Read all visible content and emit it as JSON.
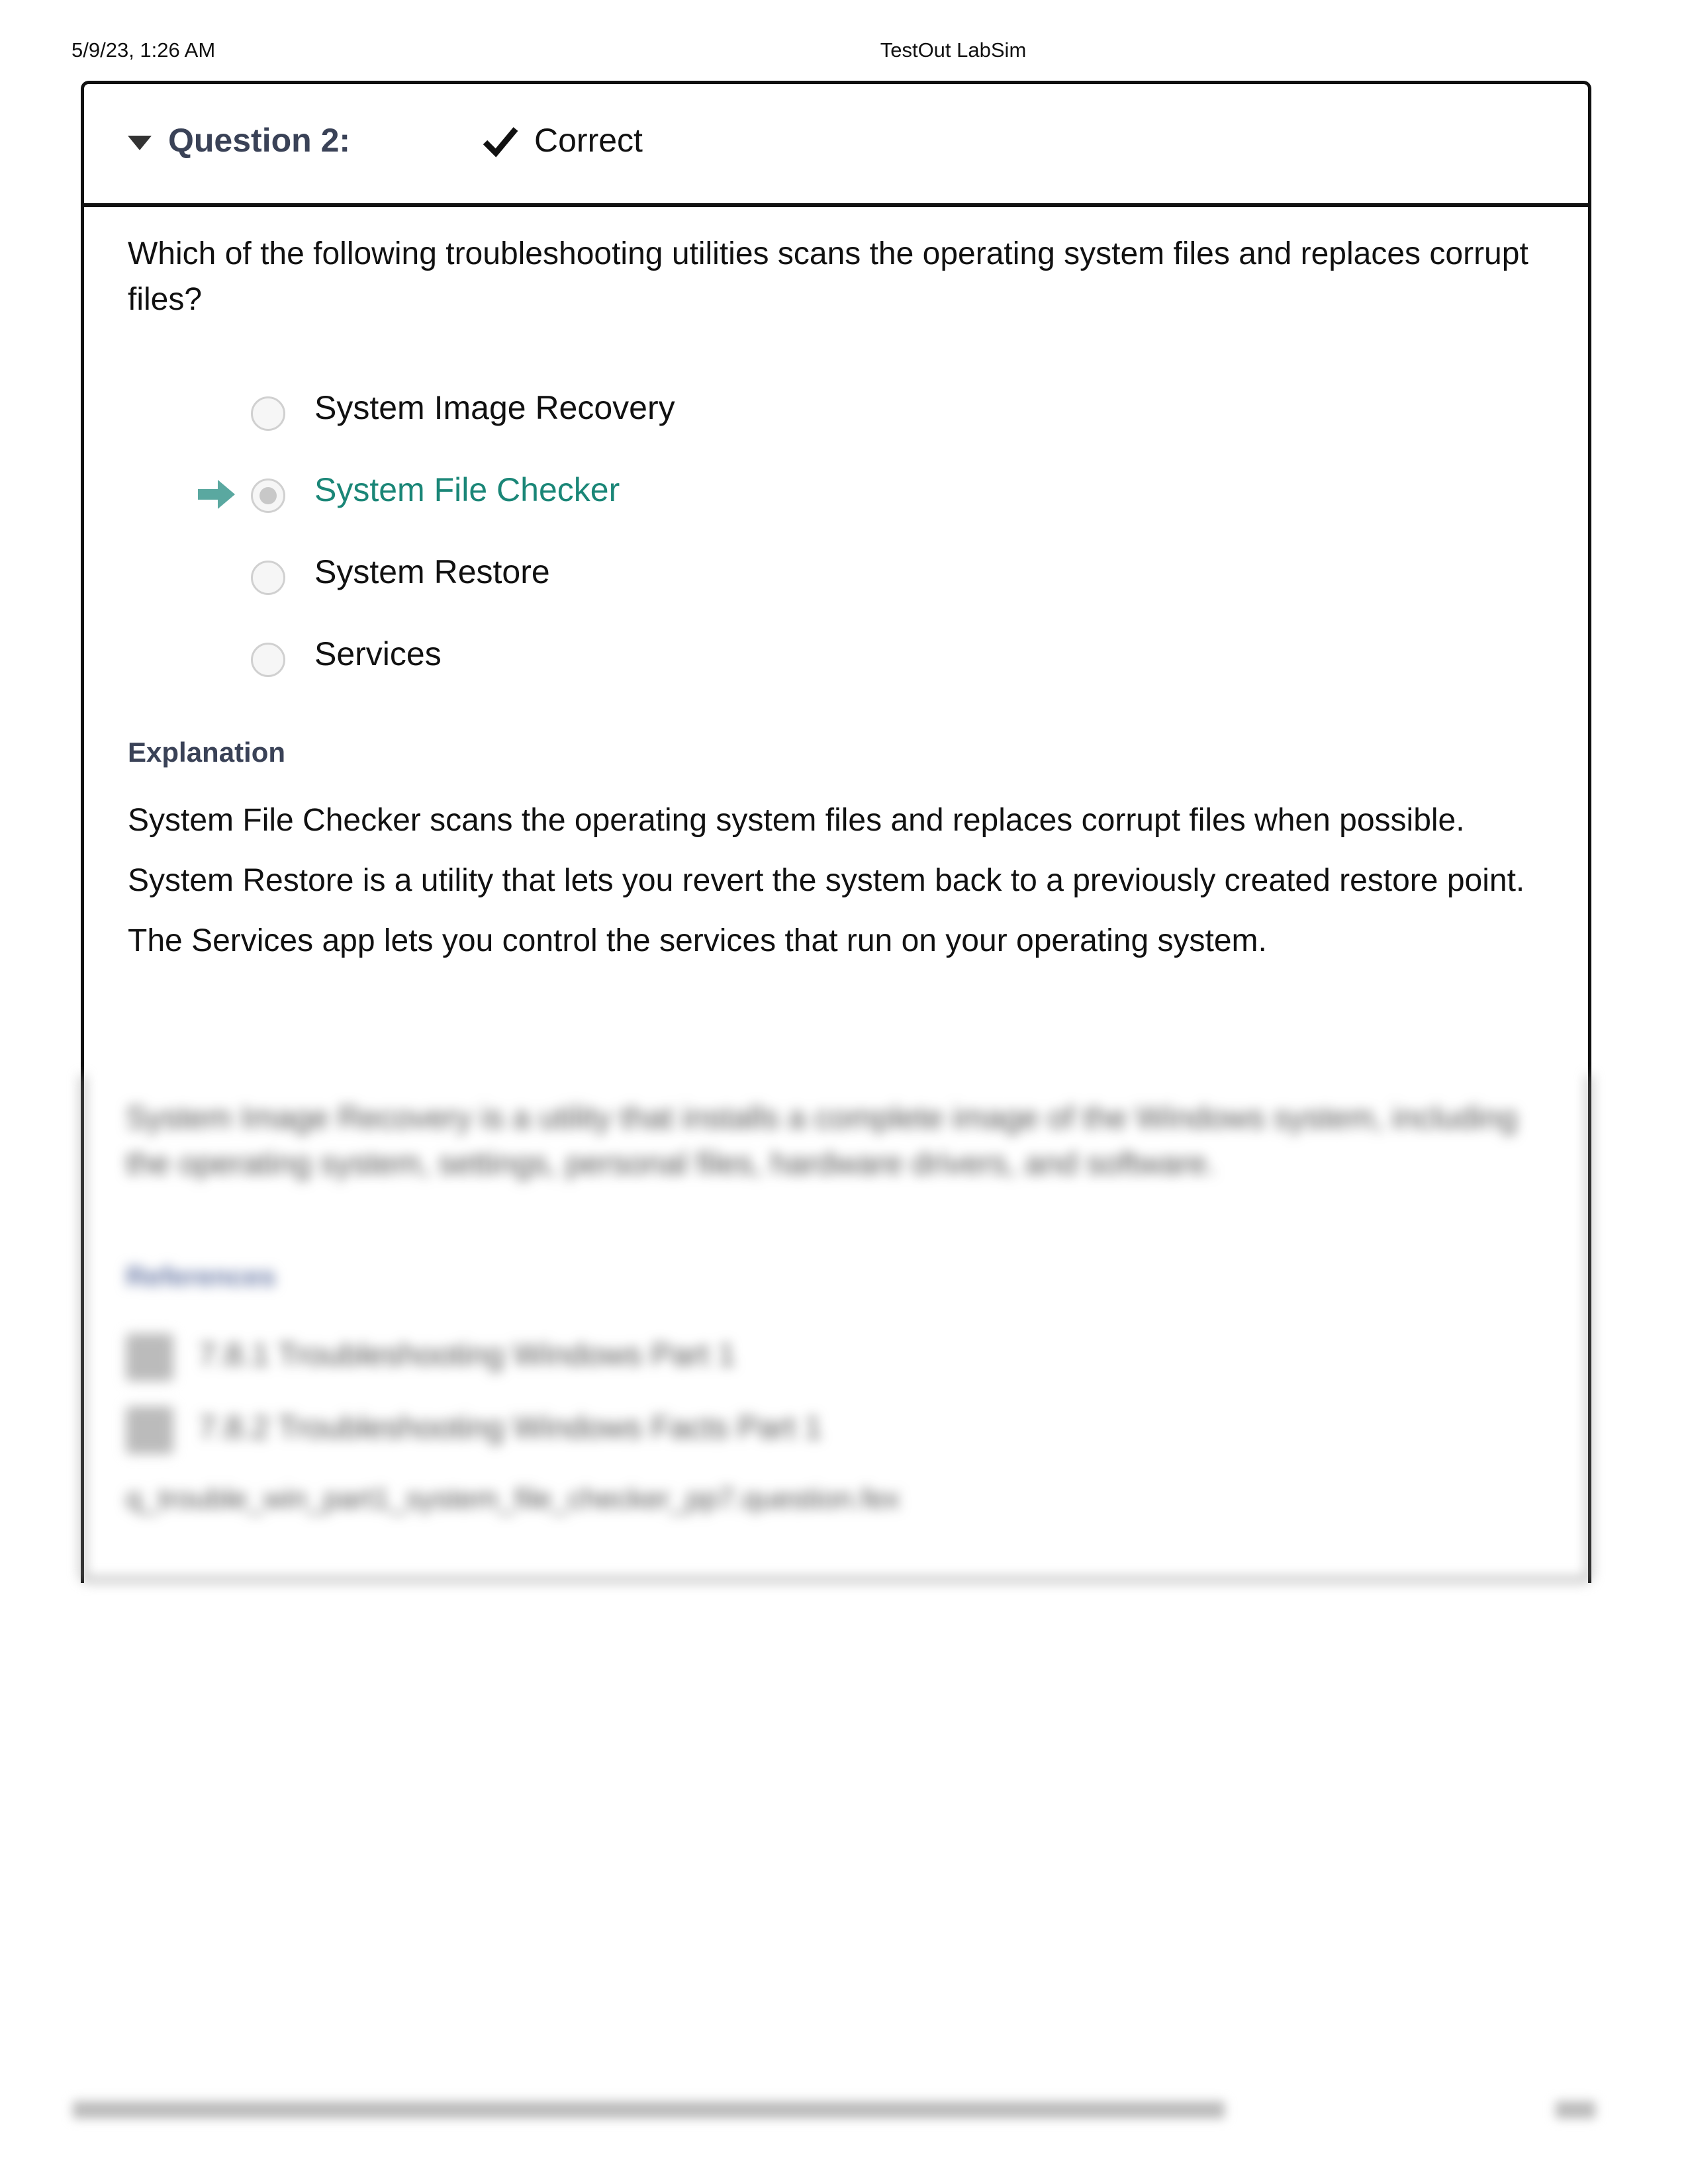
{
  "print_header": {
    "date": "5/9/23, 1:26 AM",
    "title": "TestOut LabSim"
  },
  "question": {
    "title": "Question 2:",
    "status": "Correct",
    "text": "Which of the following troubleshooting utilities scans the operating system files and replaces corrupt files?",
    "options": [
      {
        "label": "System Image Recovery",
        "selected": false,
        "correct": false
      },
      {
        "label": "System File Checker",
        "selected": true,
        "correct": true
      },
      {
        "label": "System Restore",
        "selected": false,
        "correct": false
      },
      {
        "label": "Services",
        "selected": false,
        "correct": false
      }
    ],
    "correct_color": "#1a8677"
  },
  "explanation": {
    "label": "Explanation",
    "paragraphs": [
      "System File Checker scans the operating system files and replaces corrupt files when possible.",
      "System Restore is a utility that lets you revert the system back to a previously created restore point.",
      "The Services app lets you control the services that run on your operating system."
    ],
    "blurred": {
      "paragraph": "System Image Recovery is a utility that installs a complete image of the Windows system, including the operating system, settings, personal files, hardware drivers, and software.",
      "references_label": "References",
      "references": [
        "7.8.1 Troubleshooting Windows Part 1",
        "7.8.2 Troubleshooting Windows Facts Part 1"
      ],
      "question_file": "q_trouble_win_part1_system_file_checker_pp7.question.fex"
    }
  }
}
